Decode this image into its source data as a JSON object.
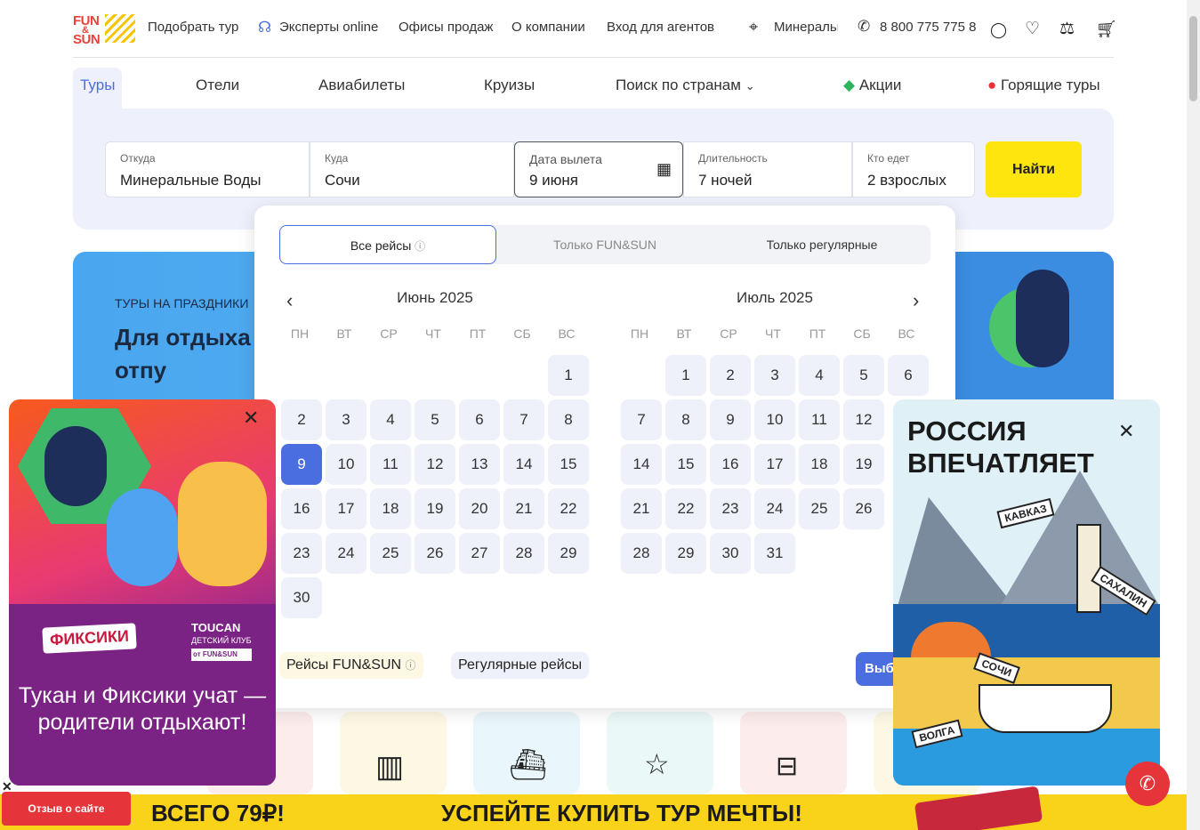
{
  "header": {
    "logo_top": "FUN",
    "logo_mid": "&",
    "logo_bottom": "SUN",
    "nav": [
      "Подобрать тур",
      "Эксперты online",
      "Офисы продаж",
      "О компании",
      "Вход для агентов"
    ],
    "city": "Минеральные Воды",
    "phone": "8 800 775 775 8"
  },
  "tabs": [
    "Туры",
    "Отели",
    "Авиабилеты",
    "Круизы",
    "Поиск по странам",
    "Акции",
    "Горящие туры"
  ],
  "search": {
    "from_label": "Откуда",
    "from_value": "Минеральные Воды",
    "to_label": "Куда",
    "to_value": "Сочи",
    "date_label": "Дата вылета",
    "date_value": "9 июня",
    "duration_label": "Длительность",
    "duration_value": "7 ночей",
    "who_label": "Кто едет",
    "who_value": "2 взрослых",
    "find": "Найти"
  },
  "promo": {
    "kicker": "ТУРЫ НА ПРАЗДНИКИ",
    "title": "Для отдыха только отпу"
  },
  "calendar": {
    "segments": [
      "Все рейсы",
      "Только FUN&SUN",
      "Только регулярные"
    ],
    "months": [
      {
        "title": "Июнь 2025",
        "offset": 6,
        "days": 30,
        "selected": 9
      },
      {
        "title": "Июль 2025",
        "offset": 1,
        "days": 31,
        "selected": null
      }
    ],
    "dow": [
      "ПН",
      "ВТ",
      "СР",
      "ЧТ",
      "ПТ",
      "СБ",
      "ВС"
    ],
    "legend_fun": "Рейсы FUN&SUN",
    "legend_regular": "Регулярные рейсы",
    "choose": "Выб"
  },
  "left_popup": {
    "brand": "ФИКСИКИ",
    "club": "TOUCAN",
    "club_sub": "ДЕТСКИЙ КЛУБ",
    "club_from": "от FUN&SUN",
    "text": "Тукан и Фиксики учат — родители отдыхают!"
  },
  "right_popup": {
    "title": "РОССИЯ ВПЕЧАТЛЯЕТ",
    "tags": [
      "КАВКАЗ",
      "САХАЛИН",
      "СОЧИ",
      "ВОЛГА"
    ]
  },
  "banner": {
    "left": "ВСЕГО 79₽!",
    "right": "УСПЕЙТЕ КУПИТЬ ТУР МЕЧТЫ!"
  },
  "feedback": "Отзыв о сайте",
  "colors": {
    "accent": "#4a6ee0",
    "yellow": "#fde50d",
    "red": "#e5353a"
  }
}
